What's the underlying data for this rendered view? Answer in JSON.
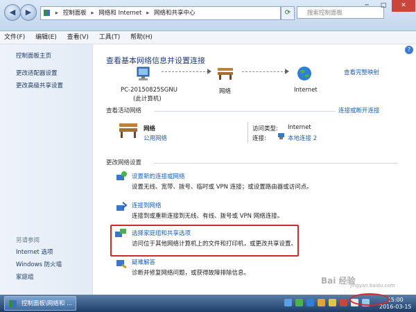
{
  "window": {
    "address": [
      "控制面板",
      "网络和 Internet",
      "网络和共享中心"
    ],
    "search_placeholder": "搜索控制面板",
    "controls": {
      "minimize": "─",
      "maximize": "□",
      "close": "✕"
    }
  },
  "menu": [
    "文件(F)",
    "编辑(E)",
    "查看(V)",
    "工具(T)",
    "帮助(H)"
  ],
  "sidebar": {
    "links": [
      "控制面板主页",
      "更改适配器设置",
      "更改高级共享设置"
    ],
    "see_also_heading": "另请参阅",
    "see_also": [
      "Internet 选项",
      "Windows 防火墙",
      "家庭组"
    ]
  },
  "main": {
    "title": "查看基本网络信息并设置连接",
    "view_full_map": "查看完整映射",
    "map": {
      "computer_name": "PC-20150825SGNU",
      "computer_sub": "(此计算机)",
      "network": "网络",
      "internet": "Internet"
    },
    "active_heading": "查看活动网络",
    "connect_disconnect": "连接或断开连接",
    "active_network": {
      "name": "网络",
      "type": "公用网络",
      "access_label": "访问类型:",
      "access_value": "Internet",
      "conn_label": "连接:",
      "conn_value": "本地连接 2"
    },
    "change_heading": "更改网络设置",
    "tasks": [
      {
        "title": "设置新的连接或网络",
        "desc": "设置无线、宽带、拨号、临时或 VPN 连接；或设置路由器或访问点。"
      },
      {
        "title": "连接到网络",
        "desc": "连接到或重新连接到无线、有线、拨号或 VPN 网络连接。"
      },
      {
        "title": "选择家庭组和共享选项",
        "desc": "访问位于其他网络计算机上的文件和打印机，或更改共享设置。"
      },
      {
        "title": "疑难解答",
        "desc": "诊断并修复网络问题，或获得故障排除信息。"
      }
    ]
  },
  "taskbar": {
    "task_label": "控制面板\\网络和 ...",
    "clock_time": "15:00",
    "clock_date": "2016-03-15"
  },
  "watermark": {
    "brand": "Bai 经验",
    "url": "jingyan.baidu.com"
  },
  "colors": {
    "link": "#1e5fb0",
    "highlight": "#cf2a27",
    "title_blue": "#1d3b7a"
  }
}
